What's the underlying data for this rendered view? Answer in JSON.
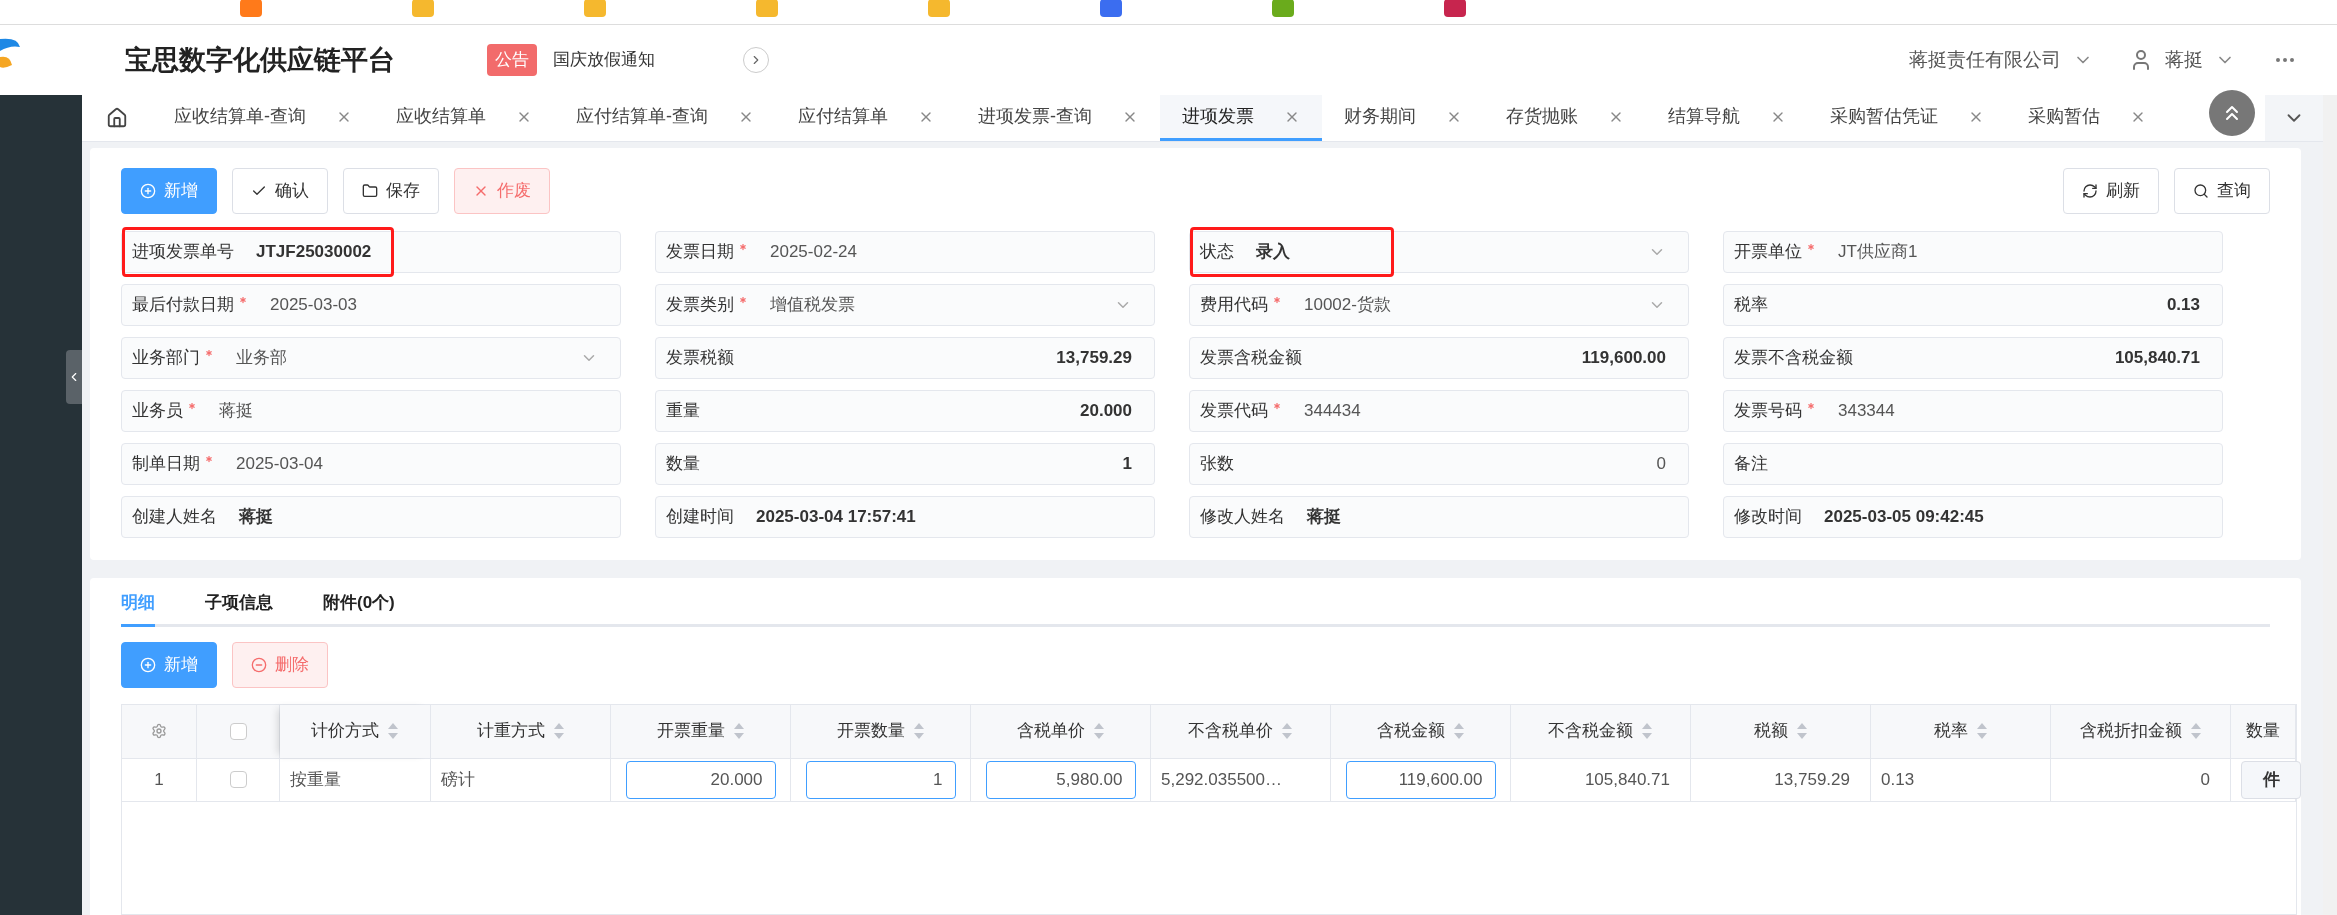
{
  "header": {
    "title": "宝思数字化供应链平台",
    "notice_badge": "公告",
    "notice": "国庆放假通知",
    "company": "蒋挺责任有限公司",
    "user": "蒋挺"
  },
  "tabs": [
    {
      "label": "应收结算单-查询",
      "selected": false
    },
    {
      "label": "应收结算单",
      "selected": false
    },
    {
      "label": "应付结算单-查询",
      "selected": false
    },
    {
      "label": "应付结算单",
      "selected": false
    },
    {
      "label": "进项发票-查询",
      "selected": false
    },
    {
      "label": "进项发票",
      "selected": true
    },
    {
      "label": "财务期间",
      "selected": false
    },
    {
      "label": "存货抛账",
      "selected": false
    },
    {
      "label": "结算导航",
      "selected": false
    },
    {
      "label": "采购暂估凭证",
      "selected": false
    },
    {
      "label": "采购暂估",
      "selected": false
    }
  ],
  "toolbar": {
    "left": [
      {
        "label": "新增",
        "kind": "primary"
      },
      {
        "label": "确认",
        "kind": "default"
      },
      {
        "label": "保存",
        "kind": "default"
      },
      {
        "label": "作废",
        "kind": "danger"
      }
    ],
    "right": [
      {
        "label": "刷新"
      },
      {
        "label": "查询"
      }
    ]
  },
  "fields": [
    {
      "label": "进项发票单号",
      "required": false,
      "kind": "static",
      "value": "JTJF25030002",
      "highlighted": true
    },
    {
      "label": "发票日期",
      "required": true,
      "kind": "text",
      "value": "2025-02-24",
      "highlighted": false
    },
    {
      "label": "状态",
      "required": false,
      "kind": "static_select",
      "value": "录入",
      "highlighted": true
    },
    {
      "label": "开票单位",
      "required": true,
      "kind": "text",
      "value": "JT供应商1",
      "highlighted": false
    },
    {
      "label": "最后付款日期",
      "required": true,
      "kind": "text",
      "value": "2025-03-03",
      "highlighted": false
    },
    {
      "label": "发票类别",
      "required": true,
      "kind": "select",
      "value": "增值税发票",
      "highlighted": false
    },
    {
      "label": "费用代码",
      "required": true,
      "kind": "select",
      "value": "10002-货款",
      "highlighted": false
    },
    {
      "label": "税率",
      "required": false,
      "kind": "amount",
      "value": "0.13",
      "highlighted": false
    },
    {
      "label": "业务部门",
      "required": true,
      "kind": "select",
      "value": "业务部",
      "highlighted": false
    },
    {
      "label": "发票税额",
      "required": false,
      "kind": "amount",
      "value": "13,759.29",
      "highlighted": false
    },
    {
      "label": "发票含税金额",
      "required": false,
      "kind": "amount",
      "value": "119,600.00",
      "highlighted": false
    },
    {
      "label": "发票不含税金额",
      "required": false,
      "kind": "amount",
      "value": "105,840.71",
      "highlighted": false
    },
    {
      "label": "业务员",
      "required": true,
      "kind": "text",
      "value": "蒋挺",
      "highlighted": false
    },
    {
      "label": "重量",
      "required": false,
      "kind": "amount",
      "value": "20.000",
      "highlighted": false
    },
    {
      "label": "发票代码",
      "required": true,
      "kind": "text",
      "value": "344434",
      "highlighted": false
    },
    {
      "label": "发票号码",
      "required": true,
      "kind": "text",
      "value": "343344",
      "highlighted": false
    },
    {
      "label": "制单日期",
      "required": true,
      "kind": "text",
      "value": "2025-03-04",
      "highlighted": false
    },
    {
      "label": "数量",
      "required": false,
      "kind": "amount",
      "value": "1",
      "highlighted": false
    },
    {
      "label": "张数",
      "required": false,
      "kind": "number",
      "value": "0",
      "highlighted": false
    },
    {
      "label": "备注",
      "required": false,
      "kind": "text",
      "highlighted": false
    },
    {
      "label": "创建人姓名",
      "required": false,
      "kind": "static",
      "value": "蒋挺",
      "highlighted": false
    },
    {
      "label": "创建时间",
      "required": false,
      "kind": "static",
      "value": "2025-03-04 17:57:41",
      "highlighted": false
    },
    {
      "label": "修改人姓名",
      "required": false,
      "kind": "static",
      "value": "蒋挺",
      "highlighted": false
    },
    {
      "label": "修改时间",
      "required": false,
      "kind": "static",
      "value": "2025-03-05 09:42:45",
      "highlighted": false
    }
  ],
  "detail_tabs": [
    {
      "label": "明细",
      "selected": true
    },
    {
      "label": "子项信息",
      "selected": false
    },
    {
      "label": "附件(0个)",
      "selected": false
    }
  ],
  "detail_toolbar": [
    {
      "label": "新增",
      "kind": "primary"
    },
    {
      "label": "删除",
      "kind": "danger"
    }
  ],
  "table": {
    "select_all": false,
    "columns": [
      {
        "label": "计价方式",
        "sortable": true
      },
      {
        "label": "计重方式",
        "sortable": true
      },
      {
        "label": "开票重量",
        "sortable": true
      },
      {
        "label": "开票数量",
        "sortable": true
      },
      {
        "label": "含税单价",
        "sortable": true
      },
      {
        "label": "不含税单价",
        "sortable": true
      },
      {
        "label": "含税金额",
        "sortable": true
      },
      {
        "label": "不含税金额",
        "sortable": true
      },
      {
        "label": "税额",
        "sortable": true
      },
      {
        "label": "税率",
        "sortable": true
      },
      {
        "label": "含税折扣金额",
        "sortable": true
      },
      {
        "label": "数量",
        "sortable": false
      }
    ],
    "rows": [
      {
        "index": "1",
        "checked": false,
        "cells": [
          {
            "kind": "text",
            "value": "按重量"
          },
          {
            "kind": "text",
            "value": "磅计"
          },
          {
            "kind": "input",
            "value": "20.000"
          },
          {
            "kind": "input",
            "value": "1"
          },
          {
            "kind": "input",
            "value": "5,980.00"
          },
          {
            "kind": "text",
            "value": "5,292.035500…"
          },
          {
            "kind": "input",
            "value": "119,600.00"
          },
          {
            "kind": "number",
            "value": "105,840.71"
          },
          {
            "kind": "number",
            "value": "13,759.29"
          },
          {
            "kind": "text",
            "value": "0.13"
          },
          {
            "kind": "number",
            "value": "0"
          },
          {
            "kind": "tag",
            "value": "件"
          }
        ]
      }
    ]
  }
}
